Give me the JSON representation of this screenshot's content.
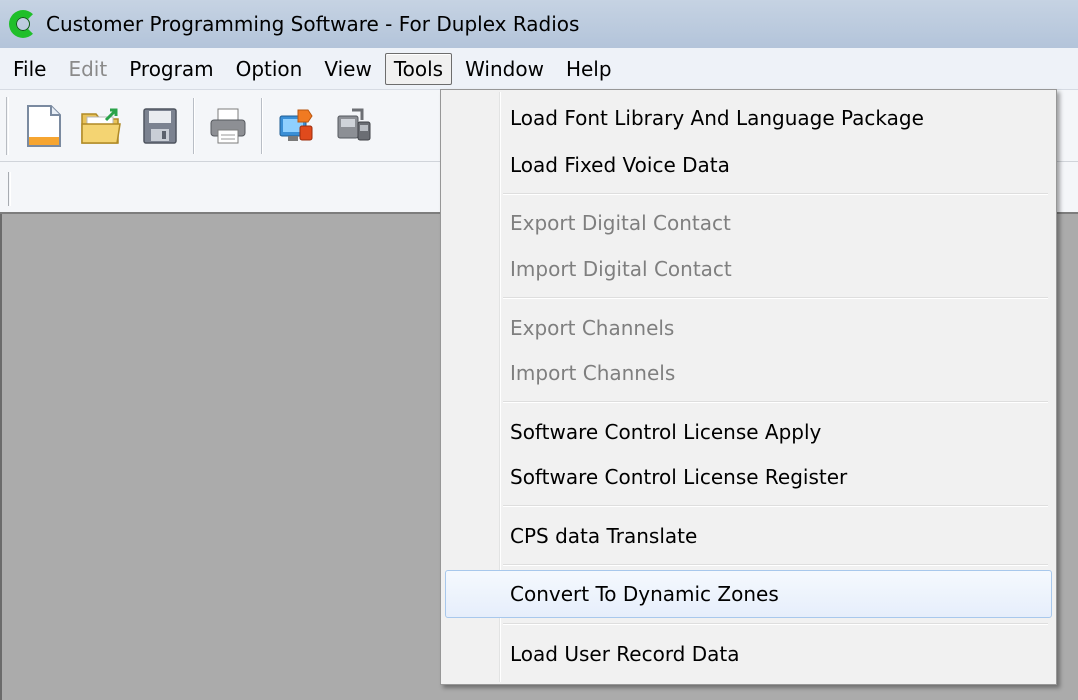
{
  "window": {
    "title": "Customer Programming Software - For Duplex Radios",
    "icon": "cps-logo-icon"
  },
  "menubar": {
    "items": [
      {
        "label": "File",
        "enabled": true
      },
      {
        "label": "Edit",
        "enabled": false
      },
      {
        "label": "Program",
        "enabled": true
      },
      {
        "label": "Option",
        "enabled": true
      },
      {
        "label": "View",
        "enabled": true
      },
      {
        "label": "Tools",
        "enabled": true,
        "active": true
      },
      {
        "label": "Window",
        "enabled": true
      },
      {
        "label": "Help",
        "enabled": true
      }
    ]
  },
  "toolbar": {
    "buttons": [
      {
        "name": "new-file-icon"
      },
      {
        "name": "open-folder-icon"
      },
      {
        "name": "save-icon"
      },
      {
        "name": "print-icon"
      },
      {
        "name": "read-from-radio-icon"
      },
      {
        "name": "write-to-radio-icon"
      }
    ]
  },
  "tools_menu": {
    "items": [
      {
        "label": "Load Font Library And Language Package",
        "enabled": true
      },
      {
        "label": "Load Fixed Voice Data",
        "enabled": true
      },
      {
        "label": "Export Digital Contact",
        "enabled": false
      },
      {
        "label": "Import Digital Contact",
        "enabled": false
      },
      {
        "label": "Export Channels",
        "enabled": false
      },
      {
        "label": "Import Channels",
        "enabled": false
      },
      {
        "label": "Software Control License Apply",
        "enabled": true
      },
      {
        "label": "Software Control License Register",
        "enabled": true
      },
      {
        "label": "CPS data Translate",
        "enabled": true
      },
      {
        "label": "Convert To Dynamic Zones",
        "enabled": true,
        "highlighted": true
      },
      {
        "label": "Load User Record Data",
        "enabled": true
      }
    ]
  },
  "colors": {
    "title_bar": "#b9c9dd",
    "workspace": "#ababab",
    "menu_background": "#f1f1f1",
    "disabled_text": "#7f7f7f",
    "highlight_border": "#a8c8ec"
  }
}
